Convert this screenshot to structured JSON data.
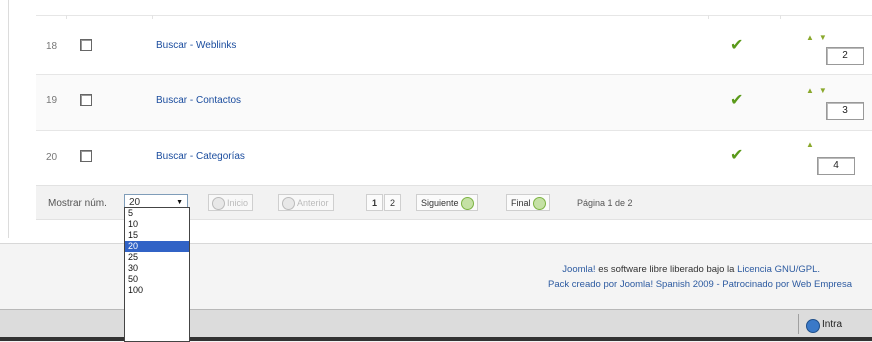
{
  "rows": [
    {
      "num": "18",
      "title": "Buscar - Weblinks",
      "order": "2"
    },
    {
      "num": "19",
      "title": "Buscar - Contactos",
      "order": "3"
    },
    {
      "num": "20",
      "title": "Buscar - Categorías",
      "order": "4"
    }
  ],
  "pager": {
    "show_label": "Mostrar núm.",
    "selected": "20",
    "start": "Inicio",
    "prev": "Anterior",
    "page1": "1",
    "page2": "2",
    "next": "Siguiente",
    "end": "Final",
    "info": "Página 1 de 2"
  },
  "dropdown_options": [
    "5",
    "10",
    "15",
    "20",
    "25",
    "30",
    "50",
    "100"
  ],
  "footer": {
    "joomla": "Joomla!",
    "mid": " es software libre liberado bajo la ",
    "license": "Licencia GNU/GPL.",
    "pack": "Pack creado por Joomla! Spanish 2009 - Patrocinado por Web Empresa"
  },
  "statusbar": {
    "zone": "Intra"
  },
  "colors": {
    "link": "#1a4c9e",
    "check": "#5a9a1a",
    "selected_option": "#3163c6"
  }
}
